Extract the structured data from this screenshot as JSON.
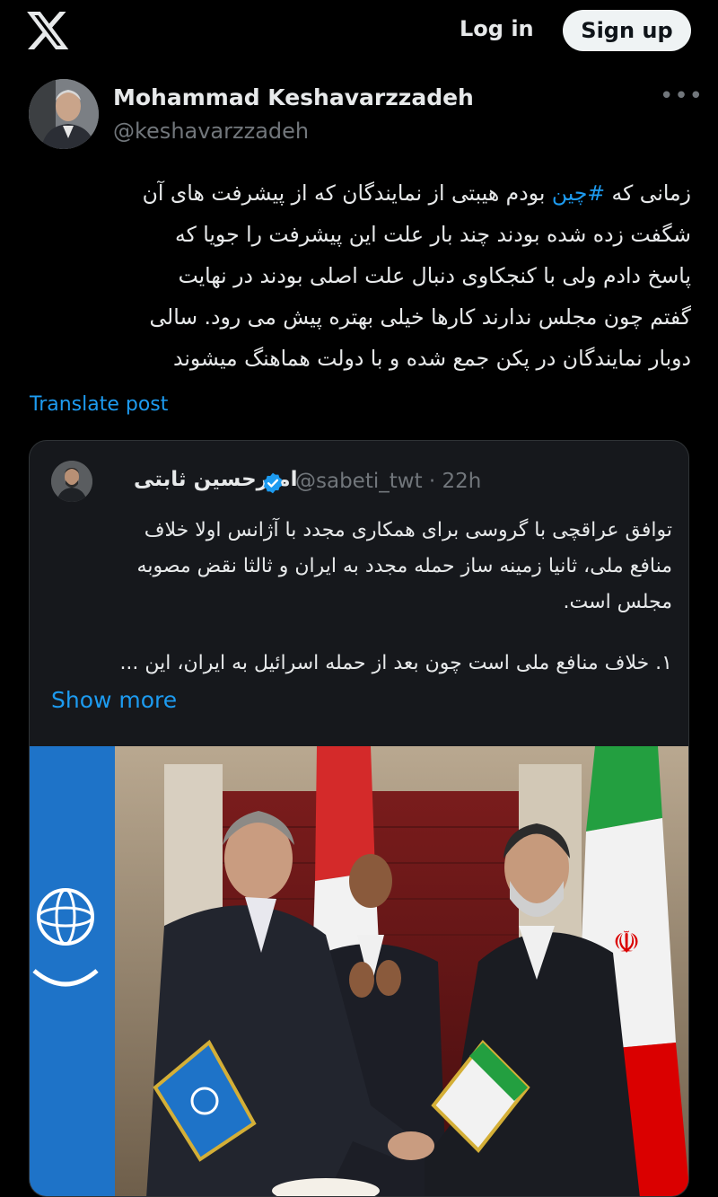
{
  "header": {
    "logo_icon": "x-logo-icon",
    "login_label": "Log in",
    "signup_label": "Sign up"
  },
  "post": {
    "author_name": "Mohammad Keshavarzzadeh",
    "author_handle": "@keshavarzzadeh",
    "more_icon": "more-dots-icon",
    "text_lines": [
      [
        "زمانی که ",
        "#چین",
        " بودم هیبتی از نمایندگان که  از پیشرفت های آن"
      ],
      "شگفت زده شده بودند چند بار علت این پیشرفت را جویا که",
      "پاسخ دادم ولی با کنجکاوی دنبال علت اصلی بودند در نهایت",
      "گفتم چون مجلس ندارند کارها خیلی بهتره پیش می رود. سالی",
      "دوبار نمایندگان در پکن جمع شده و با دولت هماهنگ میشوند"
    ],
    "translate_label": "Translate post"
  },
  "quoted_post": {
    "author_name": "امیرحسین ثابتی",
    "verified_icon": "verified-badge-icon",
    "handle_time": "@sabeti_twt · 22h",
    "text_lines": [
      "توافق عراقچی با گروسی برای همکاری مجدد با آژانس اولا خلاف",
      "منافع ملی، ثانیا زمینه ساز حمله مجدد به ایران و ثالثا نقض مصوبه",
      "مجلس است.",
      "",
      "۱. خلاف منافع ملی است چون بعد از حمله اسرائیل به ایران، این ..."
    ],
    "show_more_label": "Show more"
  },
  "colors": {
    "background": "#000000",
    "text_primary": "#e7e9ea",
    "text_secondary": "#71767b",
    "link_blue": "#1d9bf0",
    "border": "#2f3336",
    "iaea_blue": "#1e73c8",
    "iran_green": "#239f40",
    "iran_red": "#da0000"
  }
}
